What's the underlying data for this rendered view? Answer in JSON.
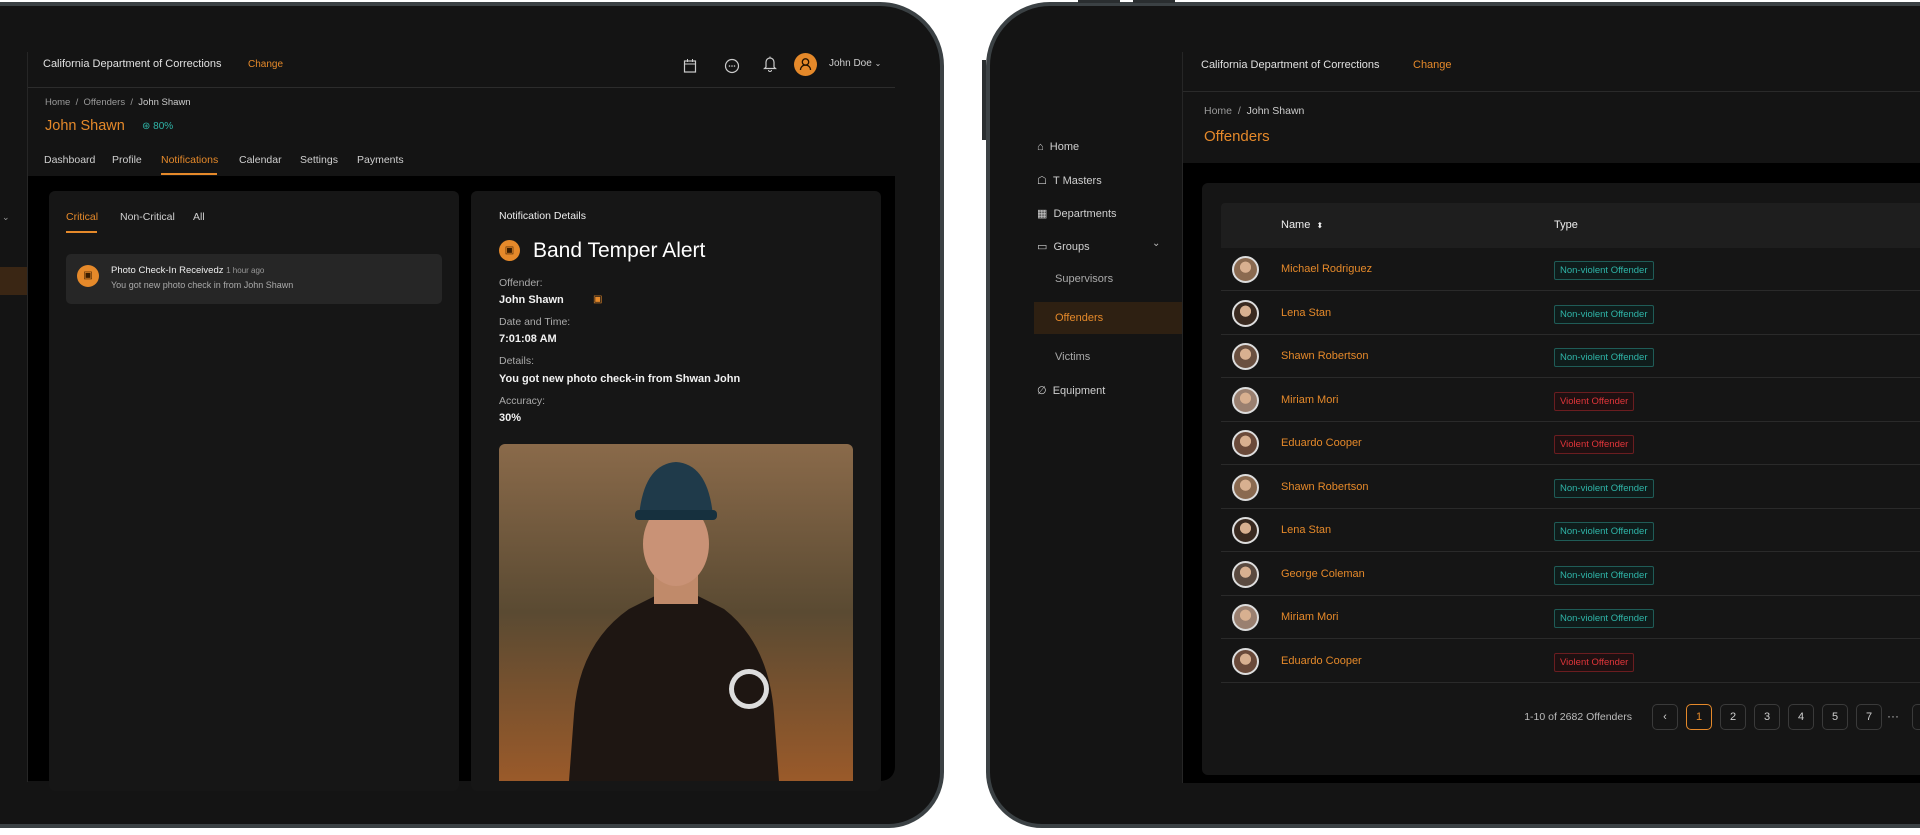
{
  "colors": {
    "accent": "#e5892a",
    "teal": "#2fb5a8",
    "violent": "#e0353a",
    "background": "#141414"
  },
  "left_screen": {
    "header": {
      "org": "California Department of Corrections",
      "change": "Change",
      "user": "John Doe",
      "icons": [
        "calendar-icon",
        "chat-icon",
        "bell-icon",
        "user-avatar-icon"
      ]
    },
    "breadcrumb": [
      "Home",
      "Offenders",
      "John Shawn"
    ],
    "title": "John Shawn",
    "score": "80%",
    "tabs": [
      "Dashboard",
      "Profile",
      "Notifications",
      "Calendar",
      "Settings",
      "Payments"
    ],
    "active_tab": "Notifications",
    "filter_tabs": [
      "Critical",
      "Non-Critical",
      "All"
    ],
    "notification": {
      "title": "Photo Check-In Receivedz",
      "time": "1 hour ago",
      "text": "You got new photo check in from John Shawn"
    },
    "details": {
      "heading": "Notification Details",
      "alert": "Band Temper Alert",
      "offender_label": "Offender:",
      "offender": "John Shawn",
      "date_label": "Date and Time:",
      "date": "7:01:08 AM",
      "details_label": "Details:",
      "details": "You got new photo check-in from Shwan John",
      "accuracy_label": "Accuracy:",
      "accuracy": "30%"
    }
  },
  "right_screen": {
    "header": {
      "org": "California Department of Corrections",
      "change": "Change"
    },
    "sidebar": [
      "Home",
      "T Masters",
      "Departments",
      "Groups",
      "Supervisors",
      "Offenders",
      "Victims",
      "Equipment"
    ],
    "active": "Offenders",
    "breadcrumb": [
      "Home",
      "John Shawn"
    ],
    "title": "Offenders",
    "columns": [
      "Name",
      "Type"
    ],
    "rows": [
      {
        "name": "Michael Rodriguez",
        "type": "Non-violent Offender",
        "violent": false
      },
      {
        "name": "Lena Stan",
        "type": "Non-violent Offender",
        "violent": false
      },
      {
        "name": "Shawn Robertson",
        "type": "Non-violent Offender",
        "violent": false
      },
      {
        "name": "Miriam Mori",
        "type": "Violent Offender",
        "violent": true
      },
      {
        "name": "Eduardo Cooper",
        "type": "Violent Offender",
        "violent": true
      },
      {
        "name": "Shawn Robertson",
        "type": "Non-violent Offender",
        "violent": false
      },
      {
        "name": "Lena Stan",
        "type": "Non-violent Offender",
        "violent": false
      },
      {
        "name": "George Coleman",
        "type": "Non-violent Offender",
        "violent": false
      },
      {
        "name": "Miriam Mori",
        "type": "Non-violent Offender",
        "violent": false
      },
      {
        "name": "Eduardo Cooper",
        "type": "Violent Offender",
        "violent": true
      }
    ],
    "pagination": {
      "summary": "1-10 of 2682 Offenders",
      "pages": [
        "1",
        "2",
        "3",
        "4",
        "5",
        "7"
      ],
      "current": "1",
      "ellipsis": "···"
    }
  }
}
